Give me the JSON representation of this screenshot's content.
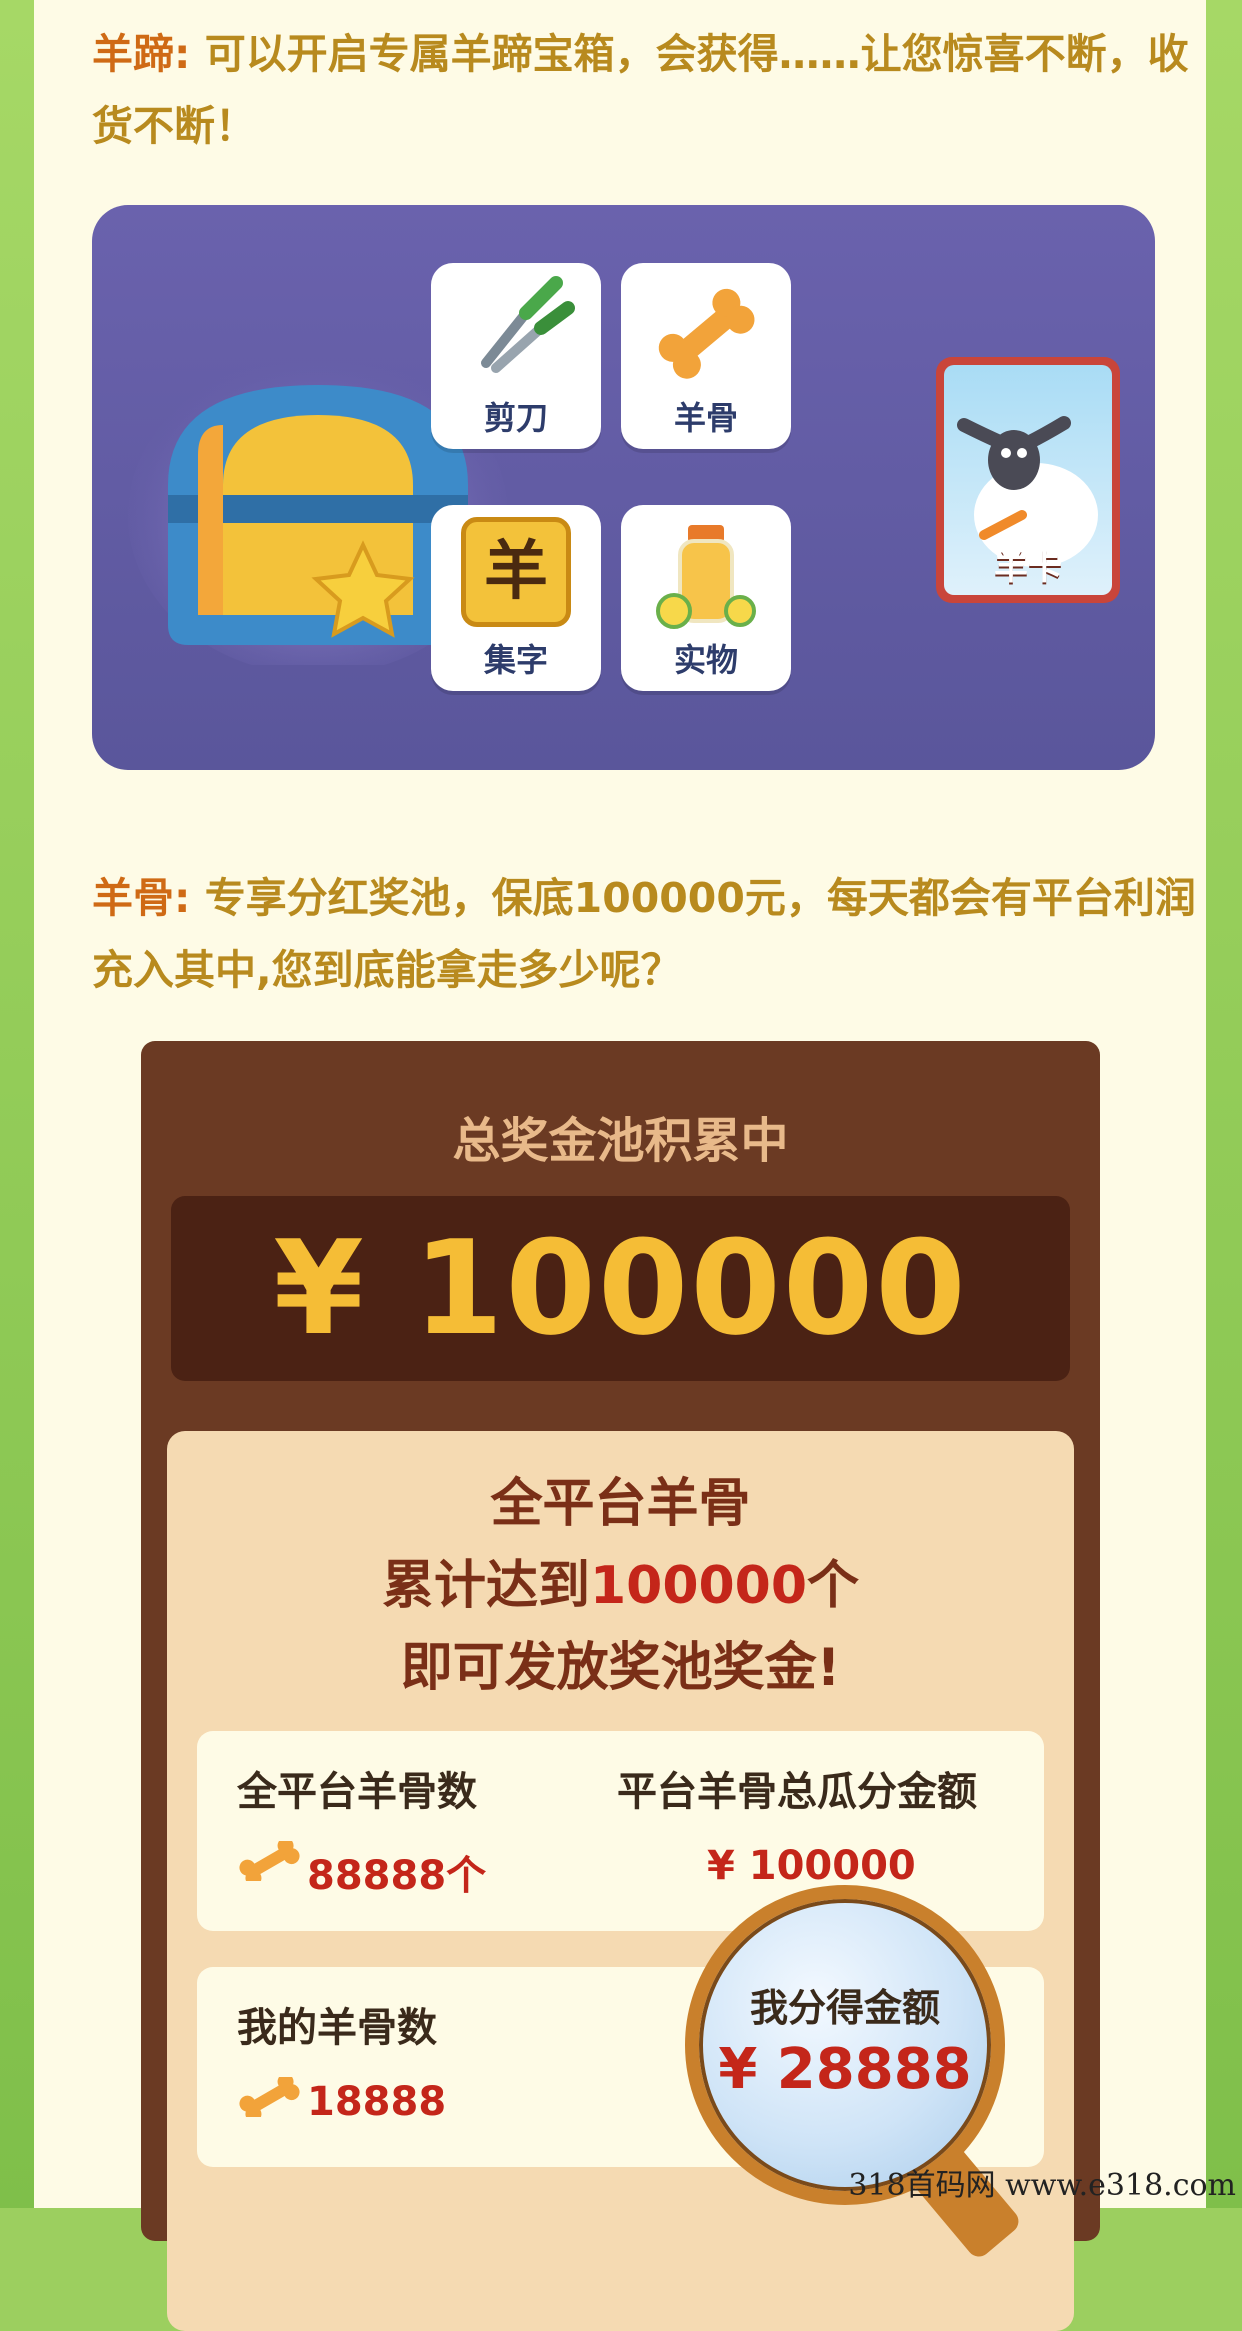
{
  "intro_hoof": {
    "lead": "羊蹄:",
    "text": "可以开启专属羊蹄宝箱，会获得……让您惊喜不断，收货不断！"
  },
  "chest_panel": {
    "items": [
      {
        "label": "剪刀",
        "icon": "scissors-icon"
      },
      {
        "label": "羊骨",
        "icon": "bone-icon"
      },
      {
        "label": "集字",
        "icon": "character-tile-icon",
        "glyph": "羊"
      },
      {
        "label": "实物",
        "icon": "juice-bottle-icon"
      }
    ],
    "card": {
      "label": "羊卡",
      "icon": "sheep-card-icon"
    }
  },
  "intro_bone": {
    "lead": "羊骨:",
    "text": "专享分红奖池，保底100000元，每天都会有平台利润充入其中,您到底能拿走多少呢？"
  },
  "pool": {
    "title": "总奖金池积累中",
    "amount": "¥ 100000"
  },
  "info": {
    "line1": "全平台羊骨",
    "line2_pre": "累计达到",
    "line2_hl": "100000",
    "line2_post": "个",
    "line3": "即可发放奖池奖金!"
  },
  "stats": {
    "row1": {
      "left_label": "全平台羊骨数",
      "left_value": "88888个",
      "right_label": "平台羊骨总瓜分金额",
      "right_value": "¥ 100000"
    },
    "row2": {
      "left_label": "我的羊骨数",
      "left_value": "18888"
    }
  },
  "magnifier": {
    "label": "我分得金额",
    "value": "¥ 28888"
  },
  "watermark": "318首码网  www.e318.com",
  "colors": {
    "panel": "#5f5aa3",
    "pool_brown": "#6b3a23",
    "gold": "#f5bd36",
    "red": "#c4261a"
  }
}
